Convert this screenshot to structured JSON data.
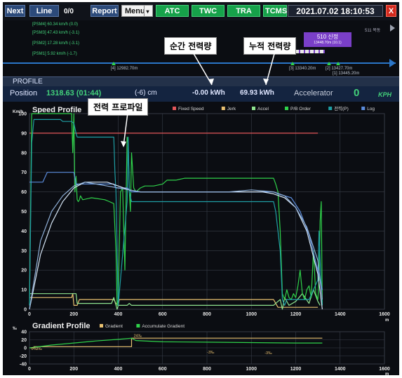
{
  "topbar": {
    "next": "Next",
    "line": "Line",
    "counter": "0/0",
    "report": "Report",
    "menu": "Menu",
    "menu_arrow": "▾",
    "atc": "ATC",
    "twc": "TWC",
    "tra": "TRA",
    "tcms": "TCMS",
    "datetime": "2021.07.02 18:10:53",
    "close": "X"
  },
  "track": {
    "psm": [
      "[PSM4] 60.34 km/h (0.0)",
      "[PSM3] 47.43 km/h (-3.1)",
      "[PSM2] 17.28 km/h (-3.1)",
      "[PSM1] 5.92 km/h (-1.7)"
    ],
    "station_right": "511 목동",
    "train_title": "510 신정",
    "train_sub": "13448.70m (10.1)",
    "markers": [
      "[4] 12982.70m",
      "[3] 13340.20m",
      "[2] 13427.70m",
      "[1] 13445.20m"
    ]
  },
  "annotations": {
    "instant": "순간 전력량",
    "cumulative": "누적 전력량",
    "profile": "전력 프로파일"
  },
  "profile": {
    "title": "PROFILE",
    "position_label": "Position",
    "position_value": "1318.63 (01:44)",
    "offset": "(-6) cm",
    "instant_power": "-0.00 kWh",
    "cumulative_power": "69.93 kWh",
    "accel_label": "Accelerator",
    "accel_value": "0",
    "kph": "KPH"
  },
  "chart_data": [
    {
      "type": "line",
      "title": "Speed Profile",
      "ylabel": "Km/h",
      "xlabel": "m",
      "xlim": [
        0,
        1600
      ],
      "ylim": [
        0,
        100
      ],
      "xticks": [
        0,
        200,
        400,
        600,
        800,
        1000,
        1200,
        1400,
        1600
      ],
      "yticks": [
        0,
        10,
        20,
        30,
        40,
        50,
        60,
        70,
        80,
        90,
        100
      ],
      "grid": true,
      "legend_position": "top",
      "series": [
        {
          "name": "Fixed Speed",
          "color": "#e4575a",
          "x": [
            0,
            1300
          ],
          "y": [
            90,
            90
          ]
        },
        {
          "name": "Jerk",
          "color": "#e8c070",
          "x": [
            0,
            190,
            195,
            200,
            215,
            225,
            380,
            390,
            400,
            405,
            440,
            460,
            1100,
            1110,
            1120,
            1200,
            1300
          ],
          "y": [
            6,
            6,
            8,
            2,
            2,
            5,
            5,
            3,
            2,
            5,
            5,
            5,
            5,
            3,
            1,
            1,
            1
          ]
        },
        {
          "name": "Accel",
          "color": "#8fe48f",
          "x": [
            0,
            180,
            200,
            210,
            215,
            225,
            370,
            380,
            390,
            395,
            400,
            420,
            440,
            450,
            460,
            1100,
            1110,
            1130,
            1140,
            1150,
            1170,
            1200,
            1230,
            1260,
            1280,
            1300,
            1310
          ],
          "y": [
            8,
            8,
            8,
            8,
            3,
            3,
            3,
            6,
            2,
            0,
            2,
            2,
            2,
            3,
            2,
            2,
            3,
            5,
            0,
            6,
            2,
            4,
            8,
            3,
            10,
            4,
            2
          ]
        },
        {
          "name": "P/B Order",
          "color": "#2fd24a",
          "x": [
            0,
            10,
            20,
            180,
            190,
            195,
            200,
            205,
            210,
            215,
            220,
            225,
            230,
            240,
            280,
            340,
            360,
            380,
            390,
            395,
            400,
            410,
            420,
            430,
            440,
            445,
            450,
            455,
            460,
            470,
            480,
            500,
            520,
            560,
            600,
            620,
            660,
            700,
            800,
            900,
            1000,
            1100,
            1110,
            1120,
            1130,
            1140,
            1150,
            1160,
            1170,
            1180,
            1190,
            1200,
            1210,
            1220,
            1230,
            1240,
            1250,
            1260,
            1270,
            1280,
            1290,
            1300,
            1305,
            1310,
            1315,
            1320
          ],
          "y": [
            2,
            100,
            100,
            100,
            100,
            80,
            100,
            60,
            68,
            56,
            55,
            56,
            58,
            56,
            57,
            56,
            55,
            54,
            30,
            2,
            5,
            60,
            62,
            20,
            88,
            85,
            60,
            50,
            80,
            62,
            60,
            62,
            63,
            63,
            64,
            66,
            66,
            67,
            67,
            67,
            67,
            67,
            64,
            60,
            40,
            8,
            5,
            10,
            6,
            5,
            8,
            6,
            12,
            20,
            8,
            5,
            10,
            12,
            6,
            30,
            8,
            5,
            15,
            45,
            55,
            2
          ]
        },
        {
          "name": "전력(P)",
          "color": "#1f9fa5",
          "x": [
            0,
            10,
            20,
            60,
            70,
            140,
            150,
            190,
            200,
            210,
            215,
            220,
            380,
            385,
            390,
            400,
            410,
            440,
            445,
            450,
            460,
            500,
            1100,
            1110,
            1130,
            1140,
            1150,
            1160,
            1180,
            1220,
            1260,
            1280,
            1300,
            1305,
            1310,
            1320
          ],
          "y": [
            2,
            85,
            97,
            97,
            97,
            97,
            96,
            96,
            95,
            90,
            88,
            88,
            88,
            70,
            60,
            2,
            15,
            55,
            88,
            60,
            55,
            55,
            55,
            50,
            30,
            5,
            2,
            5,
            5,
            5,
            5,
            10,
            15,
            40,
            25,
            2
          ]
        },
        {
          "name": "Log",
          "color": "#5b8cdb",
          "x": [
            0,
            60,
            80,
            200,
            210,
            380,
            390,
            440,
            460,
            1100,
            1120,
            1180,
            1220,
            1260,
            1300,
            1320
          ],
          "y": [
            65,
            65,
            70,
            70,
            64,
            64,
            62,
            62,
            60,
            60,
            59,
            57,
            50,
            38,
            20,
            10
          ]
        },
        {
          "name": "",
          "color": "#d6e6f6",
          "x": [
            0,
            50,
            100,
            150,
            200,
            250,
            300,
            350,
            400,
            450,
            500,
            600,
            700,
            800,
            900,
            1000,
            1050,
            1100,
            1150,
            1200,
            1250,
            1300,
            1320
          ],
          "y": [
            0,
            28,
            44,
            55,
            62,
            65,
            65,
            65,
            63,
            61,
            60,
            60,
            60,
            60,
            60,
            60,
            60,
            59,
            57,
            52,
            40,
            18,
            0
          ]
        },
        {
          "name": "",
          "color": "#8fb0d8",
          "x": [
            0,
            50,
            100,
            150,
            200,
            250,
            300,
            350,
            400,
            450,
            500,
            600,
            700,
            800,
            900,
            1000,
            1100,
            1150,
            1200,
            1250,
            1300,
            1320
          ],
          "y": [
            0,
            35,
            50,
            58,
            63,
            65,
            64,
            63,
            62,
            61,
            60,
            60,
            60,
            60,
            60,
            61,
            60,
            58,
            52,
            42,
            25,
            5
          ]
        }
      ]
    },
    {
      "type": "line",
      "title": "Gradient Profile",
      "ylabel": "‰",
      "xlabel": "m",
      "xlim": [
        0,
        1600
      ],
      "ylim": [
        -40,
        40
      ],
      "xticks": [
        0,
        200,
        400,
        600,
        800,
        1000,
        1200,
        1400,
        1600
      ],
      "yticks": [
        -40,
        -20,
        0,
        20,
        40
      ],
      "grid": true,
      "legend_position": "top",
      "series": [
        {
          "name": "Gradient",
          "color": "#e8c070",
          "x": [
            0,
            20,
            20,
            460,
            460,
            1320
          ],
          "y": [
            0,
            0,
            3,
            3,
            24,
            24
          ]
        },
        {
          "name": "Accumulate Gradient",
          "color": "#2fd24a",
          "x": [
            0,
            30,
            100,
            200,
            300,
            400,
            460,
            480,
            600,
            800,
            1000,
            1200,
            1320
          ],
          "y": [
            0,
            2,
            7,
            12,
            17,
            21,
            24,
            18,
            15,
            14,
            13,
            12,
            12
          ]
        }
      ],
      "annotations": [
        "0%",
        "3‰",
        "24‰",
        "-3‰",
        "-3‰"
      ]
    }
  ]
}
